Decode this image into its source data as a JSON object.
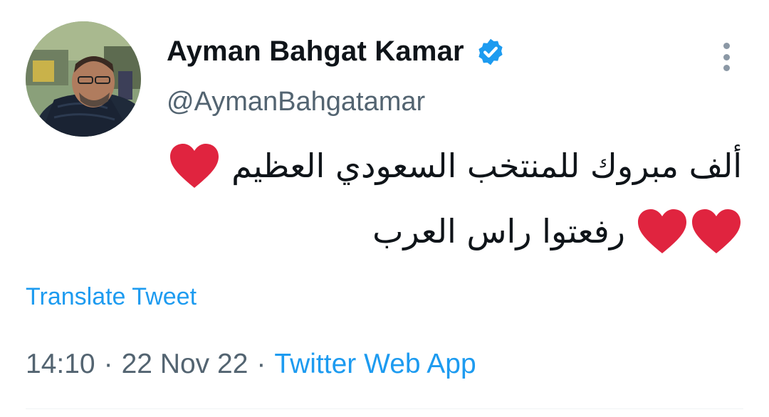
{
  "author": {
    "name": "Ayman Bahgat Kamar",
    "handle": "@AymanBahgatamar",
    "verified": true
  },
  "tweet": {
    "line1": "ألف مبروك للمنتخب السعودي العظيم",
    "line2": "رفعتوا راس العرب",
    "emoji": "heart-emoji"
  },
  "actions": {
    "translate_label": "Translate Tweet"
  },
  "meta": {
    "time": "14:10",
    "separator": "·",
    "date": "22 Nov 22",
    "source": "Twitter Web App"
  },
  "colors": {
    "link": "#1d9bf0",
    "heart": "#e0243f",
    "secondary_text": "#536471"
  }
}
